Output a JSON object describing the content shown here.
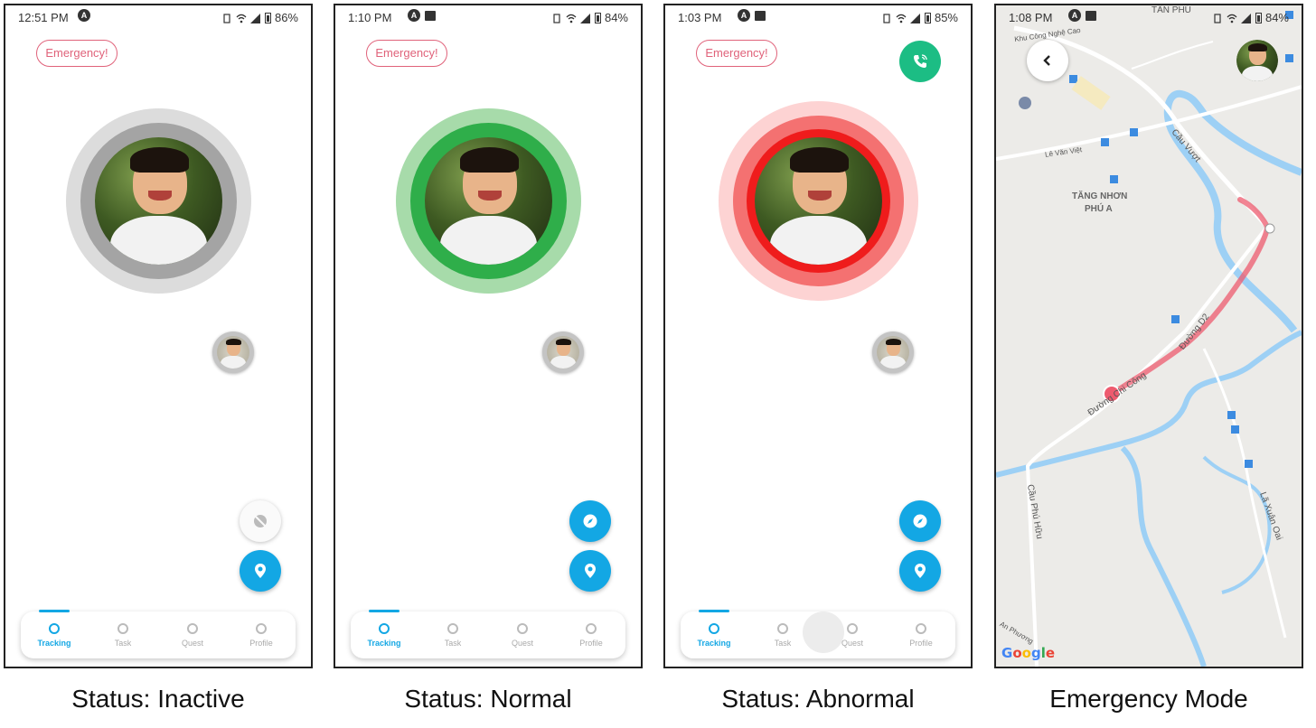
{
  "colors": {
    "accent": "#13a7e4",
    "emergency": "#e0627a",
    "inactive_outer": "#dcdcdc",
    "inactive_inner": "#a4a4a4",
    "normal_outer": "#a7dbaa",
    "normal_inner": "#2fae4a",
    "abnormal_outer": "#fdd3d3",
    "abnormal_mid": "#f47171",
    "abnormal_inner": "#ef1c1c",
    "call": "#1cbd84",
    "route": "#ee5b6f"
  },
  "screens": [
    {
      "status_bar": {
        "time": "12:51 PM",
        "battery": "86%"
      },
      "emergency_label": "Emergency!",
      "caption": "Status: Inactive"
    },
    {
      "status_bar": {
        "time": "1:10 PM",
        "battery": "84%"
      },
      "emergency_label": "Emergency!",
      "caption": "Status: Normal"
    },
    {
      "status_bar": {
        "time": "1:03 PM",
        "battery": "85%"
      },
      "emergency_label": "Emergency!",
      "caption": "Status: Abnormal"
    },
    {
      "status_bar": {
        "time": "1:08 PM",
        "battery": "84%"
      },
      "caption": "Emergency Mode",
      "map": {
        "labels": {
          "tan_phu": "TÂN PHÚ",
          "khu_cong_nghe_cao": "Khu Công Nghệ Cao",
          "le_van_viet": "Lê Văn Việt",
          "cau_vuot": "Cầu Vượt",
          "tang_nhon_phu_a_1": "TĂNG NHƠN",
          "tang_nhon_phu_a_2": "PHÚ A",
          "duong_d2": "Đường D2",
          "duong_chi_cong": "Đường Chi Công",
          "cau_phu_huu": "Cầu Phú Hữu",
          "la_xuan_oai": "Lã Xuân Oai",
          "an_phuong": "An Phương"
        },
        "logo": "Google"
      }
    }
  ],
  "nav": {
    "items": [
      "Tracking",
      "Task",
      "Quest",
      "Profile"
    ],
    "active": "Tracking"
  }
}
